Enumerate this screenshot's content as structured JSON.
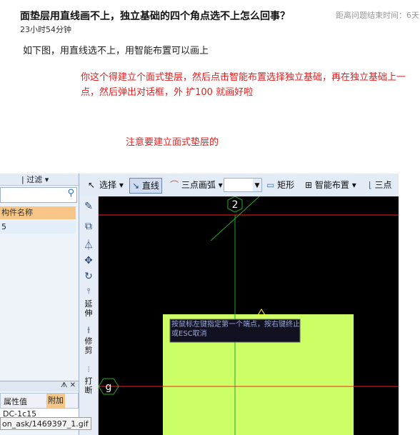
{
  "question": {
    "title": "面垫层用直线画不上，独立基础的四个角点选不上怎么回事？",
    "posted": "23小时54分钟",
    "time_left": "距离问题结束时间：6天",
    "body": "如下图，用直线选不上，用智能布置可以画上"
  },
  "answer": {
    "line1": "你这个得建立个面式垫层，然后点击智能布置选择独立基础，再在独立基础上一点，然后弹出对话框，外 扩100 就画好啦",
    "line2": "注意要建立面式垫层的"
  },
  "screenshot": {
    "left_panel": {
      "top_label": "| 过滤 ▾",
      "header": "构件名称",
      "row": "5",
      "props_bar": "ᗑ ✕",
      "col1": "属性值",
      "col2": "附加",
      "row2": "DC-1c15"
    },
    "url_tooltip": "on_ask/1469397_1.gif",
    "toolbar": {
      "select": "选择",
      "line": "直线",
      "arc": "三点画弧",
      "rect": "矩形",
      "smart": "智能布置",
      "three_point": "三点"
    },
    "vertical_tools": {
      "extend": "延伸",
      "trim": "修剪",
      "break": "打断"
    },
    "canvas": {
      "axis_top": "2",
      "axis_left": "g",
      "hint": "按鼠标左键指定第一个端点，按右键终止或ESC取消",
      "colors": {
        "bg": "#000000",
        "pad": "#ccff66",
        "axis_red": "#ff2020",
        "axis_green": "#22aa22"
      }
    }
  }
}
